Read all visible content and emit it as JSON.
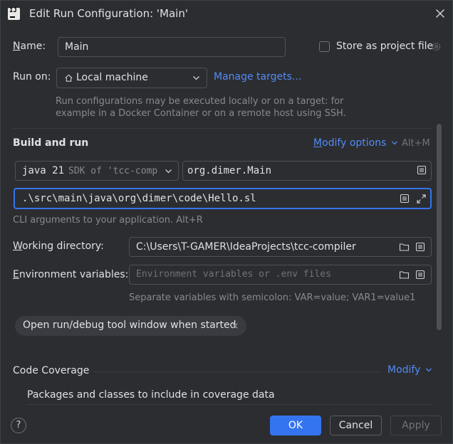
{
  "window": {
    "title": "Edit Run Configuration: 'Main'"
  },
  "name": {
    "label_pre": "",
    "label_u": "N",
    "label_post": "ame:",
    "value": "Main"
  },
  "store": {
    "label": "Store as project file"
  },
  "run_on": {
    "label": "Run on:",
    "value": "Local machine",
    "manage_link": "Manage targets..."
  },
  "run_on_hint": {
    "line1": "Run configurations may be executed locally or on a target: for",
    "line2": "example in a Docker Container or on a remote host using SSH."
  },
  "build": {
    "heading": "Build and run",
    "modify_u": "M",
    "modify_rest": "odify options",
    "shortcut": "Alt+M",
    "jdk_name": "java 21",
    "jdk_desc": "SDK of 'tcc-comp",
    "main_class": "org.dimer.Main",
    "program_args": ".\\src\\main\\java\\org\\dimer\\code\\Hello.sl",
    "args_hint": "CLI arguments to your application. Alt+R"
  },
  "workdir": {
    "label_u": "W",
    "label_rest": "orking directory:",
    "value": "C:\\Users\\T-GAMER\\IdeaProjects\\tcc-compiler"
  },
  "env": {
    "label_u": "E",
    "label_rest": "nvironment variables:",
    "placeholder": "Environment variables or .env files",
    "hint": "Separate variables with semicolon: VAR=value; VAR1=value1"
  },
  "chip": {
    "label": "Open run/debug tool window when started"
  },
  "coverage": {
    "heading": "Code Coverage",
    "modify": "Modify",
    "packages": "Packages and classes to include in coverage data"
  },
  "footer": {
    "help": "?",
    "ok": "OK",
    "cancel": "Cancel",
    "apply": "Apply"
  },
  "colors": {
    "accent": "#3574f0",
    "link": "#548af7",
    "background": "#2b2d30"
  }
}
